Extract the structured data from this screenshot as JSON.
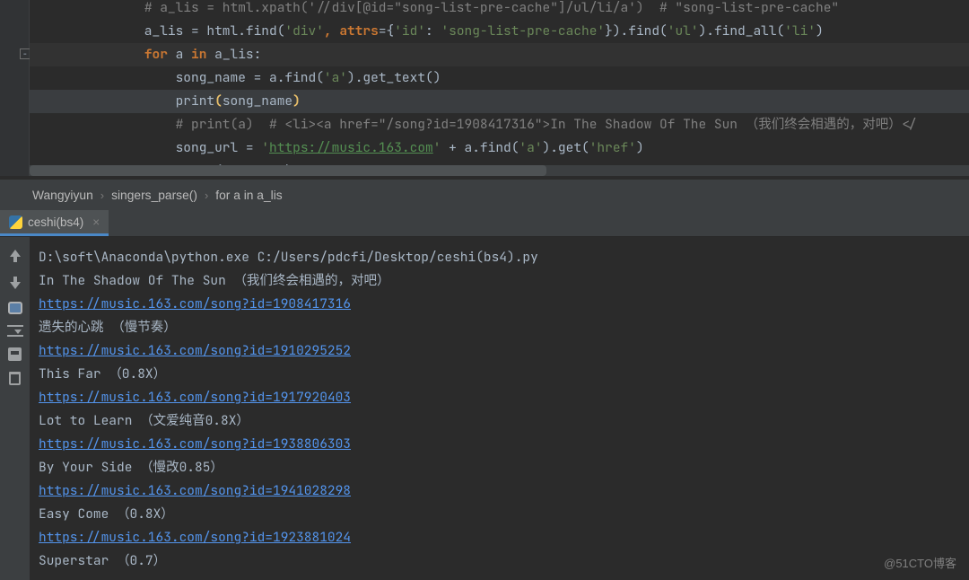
{
  "editor": {
    "lines": [
      {
        "cls": "",
        "segs": [
          {
            "t": "              ",
            "c": ""
          },
          {
            "t": "# a_lis = html.xpath('//div[@id=\"song-list-pre-cache\"]/ul/li/a')  # \"song-list-pre-cache\"",
            "c": "cmt"
          }
        ]
      },
      {
        "cls": "",
        "segs": [
          {
            "t": "              a_lis ",
            "c": ""
          },
          {
            "t": "=",
            "c": ""
          },
          {
            "t": " html.find(",
            "c": ""
          },
          {
            "t": "'div'",
            "c": "str"
          },
          {
            "t": ",",
            "c": "kw"
          },
          {
            "t": " ",
            "c": ""
          },
          {
            "t": "attrs",
            "c": "kw"
          },
          {
            "t": "={",
            "c": ""
          },
          {
            "t": "'id'",
            "c": "str"
          },
          {
            "t": ": ",
            "c": ""
          },
          {
            "t": "'song-list-pre-cache'",
            "c": "str"
          },
          {
            "t": "}).find(",
            "c": ""
          },
          {
            "t": "'ul'",
            "c": "str"
          },
          {
            "t": ").find_all(",
            "c": ""
          },
          {
            "t": "'li'",
            "c": "str"
          },
          {
            "t": ")",
            "c": ""
          }
        ]
      },
      {
        "cls": "hl",
        "segs": [
          {
            "t": "              ",
            "c": ""
          },
          {
            "t": "for",
            "c": "kw"
          },
          {
            "t": " a ",
            "c": ""
          },
          {
            "t": "in",
            "c": "kw"
          },
          {
            "t": " a_lis:",
            "c": ""
          }
        ]
      },
      {
        "cls": "",
        "segs": [
          {
            "t": "                  song_name = a.find(",
            "c": ""
          },
          {
            "t": "'a'",
            "c": "str"
          },
          {
            "t": ").get_text()",
            "c": ""
          }
        ]
      },
      {
        "cls": "cur",
        "segs": [
          {
            "t": "                  ",
            "c": ""
          },
          {
            "t": "print",
            "c": ""
          },
          {
            "t": "(",
            "c": "par"
          },
          {
            "t": "song_name",
            "c": ""
          },
          {
            "t": ")",
            "c": "par"
          }
        ]
      },
      {
        "cls": "",
        "segs": [
          {
            "t": "                  ",
            "c": ""
          },
          {
            "t": "# print(a)  # <li><a href=\"/song?id=1908417316\">In The Shadow Of The Sun （我们终会相遇的，对吧）</",
            "c": "cmt"
          }
        ]
      },
      {
        "cls": "",
        "segs": [
          {
            "t": "                  song_url = ",
            "c": ""
          },
          {
            "t": "'",
            "c": "str"
          },
          {
            "t": "https://music.163.com",
            "c": "lnk"
          },
          {
            "t": "'",
            "c": "str"
          },
          {
            "t": " + a.find(",
            "c": ""
          },
          {
            "t": "'a'",
            "c": "str"
          },
          {
            "t": ").get(",
            "c": ""
          },
          {
            "t": "'href'",
            "c": "str"
          },
          {
            "t": ")",
            "c": ""
          }
        ]
      },
      {
        "cls": "",
        "segs": [
          {
            "t": "                  print(song_url)",
            "c": ""
          }
        ]
      }
    ]
  },
  "breadcrumb": {
    "items": [
      "Wangyiyun",
      "singers_parse()",
      "for a in a_lis"
    ]
  },
  "run_tab": {
    "label": "ceshi(bs4)"
  },
  "console": {
    "lines": [
      {
        "type": "text",
        "value": "D:\\soft\\Anaconda\\python.exe C:/Users/pdcfi/Desktop/ceshi(bs4).py"
      },
      {
        "type": "text",
        "value": "In The Shadow Of The Sun （我们终会相遇的，对吧）"
      },
      {
        "type": "link",
        "value": "https://music.163.com/song?id=1908417316"
      },
      {
        "type": "text",
        "value": "遗失的心跳 （慢节奏）"
      },
      {
        "type": "link",
        "value": "https://music.163.com/song?id=1910295252"
      },
      {
        "type": "text",
        "value": "This Far （0.8X）"
      },
      {
        "type": "link",
        "value": "https://music.163.com/song?id=1917920403"
      },
      {
        "type": "text",
        "value": "Lot to Learn （文爱纯音0.8X）"
      },
      {
        "type": "link",
        "value": "https://music.163.com/song?id=1938806303"
      },
      {
        "type": "text",
        "value": "By Your Side （慢改0.85）"
      },
      {
        "type": "link",
        "value": "https://music.163.com/song?id=1941028298"
      },
      {
        "type": "text",
        "value": "Easy Come （0.8X）"
      },
      {
        "type": "link",
        "value": "https://music.163.com/song?id=1923881024"
      },
      {
        "type": "text",
        "value": "Superstar （0.7）"
      }
    ]
  },
  "tool_buttons": [
    {
      "name": "prev-trace-icon",
      "cls": "up"
    },
    {
      "name": "next-trace-icon",
      "cls": "down"
    },
    {
      "name": "soft-wrap-icon",
      "cls": "wrap"
    },
    {
      "name": "scroll-to-end-icon",
      "cls": "scroll"
    },
    {
      "name": "print-icon",
      "cls": "print"
    },
    {
      "name": "clear-all-icon",
      "cls": "trash"
    }
  ],
  "watermark": "@51CTO博客"
}
